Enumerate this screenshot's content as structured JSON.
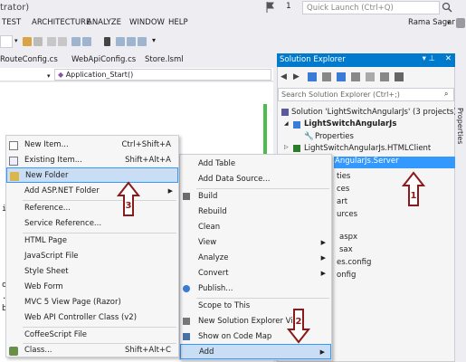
{
  "window": {
    "title_fragment": "trator)",
    "notification_count": "1",
    "quick_launch_placeholder": "Quick Launch (Ctrl+Q)",
    "user_name": "Rama Sagar"
  },
  "menubar": [
    "TEST",
    "ARCHITECTURE",
    "ANALYZE",
    "WINDOW",
    "HELP"
  ],
  "editor": {
    "tabs": [
      "RouteConfig.cs",
      "WebApiConfig.cs",
      "Store.lsml"
    ],
    "navigation_member": "Application_Start()",
    "code_fragments": [
      "ic",
      "ob",
      ".R",
      "bl"
    ]
  },
  "solution_explorer": {
    "title": "Solution Explorer",
    "search_placeholder": "Search Solution Explorer (Ctrl+;)",
    "tree": [
      "Solution 'LightSwitchAngularJs' (3 projects)",
      "LightSwitchAngularJs",
      "Properties",
      "LightSwitchAngularJs.HTMLClient",
      "AngularJs.Server",
      "ties",
      "ces",
      "art",
      "urces",
      "aspx",
      "sax",
      "es.config",
      "onfig"
    ]
  },
  "properties_tab": "Properties",
  "add_submenu": {
    "items": [
      {
        "label": "New Item...",
        "shortcut": "Ctrl+Shift+A",
        "icon": "new-item-icon"
      },
      {
        "label": "Existing Item...",
        "shortcut": "Shift+Alt+A",
        "icon": "existing-item-icon"
      },
      {
        "label": "New Folder",
        "shortcut": "",
        "icon": "folder-icon"
      },
      {
        "label": "Add ASP.NET Folder",
        "shortcut": "",
        "icon": ""
      },
      {
        "label": "Reference...",
        "shortcut": "",
        "icon": ""
      },
      {
        "label": "Service Reference...",
        "shortcut": "",
        "icon": ""
      },
      {
        "label": "HTML Page",
        "shortcut": "",
        "icon": ""
      },
      {
        "label": "JavaScript File",
        "shortcut": "",
        "icon": ""
      },
      {
        "label": "Style Sheet",
        "shortcut": "",
        "icon": ""
      },
      {
        "label": "Web Form",
        "shortcut": "",
        "icon": ""
      },
      {
        "label": "MVC 5 View Page (Razor)",
        "shortcut": "",
        "icon": ""
      },
      {
        "label": "Web API Controller Class (v2)",
        "shortcut": "",
        "icon": ""
      },
      {
        "label": "CoffeeScript File",
        "shortcut": "",
        "icon": ""
      },
      {
        "label": "Class...",
        "shortcut": "Shift+Alt+C",
        "icon": "class-icon"
      }
    ]
  },
  "project_menu": {
    "items": [
      {
        "label": "Add Table"
      },
      {
        "label": "Add Data Source..."
      },
      {
        "label": "Build"
      },
      {
        "label": "Rebuild"
      },
      {
        "label": "Clean"
      },
      {
        "label": "View"
      },
      {
        "label": "Analyze"
      },
      {
        "label": "Convert"
      },
      {
        "label": "Publish..."
      },
      {
        "label": "Scope to This"
      },
      {
        "label": "New Solution Explorer View"
      },
      {
        "label": "Show on Code Map"
      },
      {
        "label": "Add"
      }
    ]
  },
  "annotations": [
    "1",
    "2",
    "3"
  ],
  "colors": {
    "accent": "#007acc",
    "annotation": "#8b1a1a",
    "highlight": "#c9def5"
  }
}
